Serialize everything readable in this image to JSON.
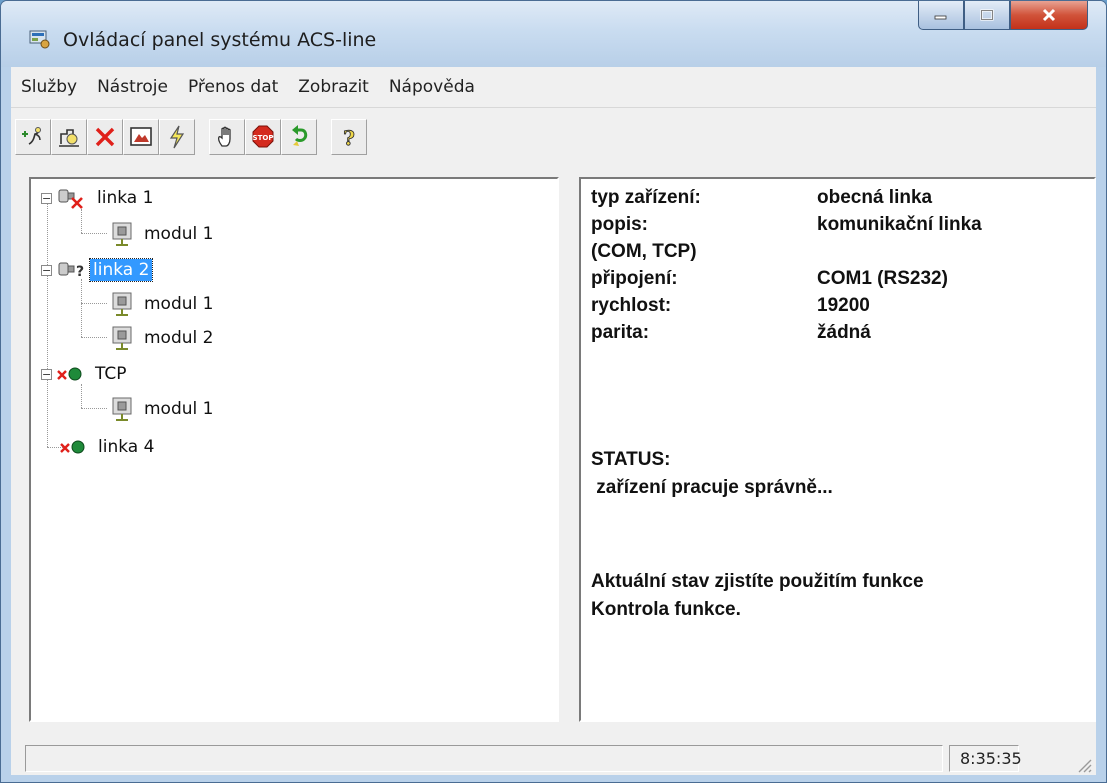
{
  "window": {
    "title": "Ovládací panel systému ACS-line"
  },
  "menu": [
    "Služby",
    "Nástroje",
    "Přenos dat",
    "Zobrazit",
    "Nápověda"
  ],
  "toolbar": {
    "buttons": [
      {
        "icon": "add-device-icon"
      },
      {
        "icon": "device-properties-icon"
      },
      {
        "icon": "delete-icon"
      },
      {
        "icon": "picture-icon"
      },
      {
        "icon": "lightning-icon"
      },
      {
        "icon": "hand-icon"
      },
      {
        "icon": "stop-icon"
      },
      {
        "icon": "undo-arrow-icon"
      },
      {
        "icon": "help-icon"
      }
    ]
  },
  "tree": {
    "nodes": [
      {
        "label": "linka 1",
        "level": 0,
        "expander": "−",
        "icon": "line-error-icon"
      },
      {
        "label": "modul 1",
        "level": 1,
        "icon": "module-icon"
      },
      {
        "label": "linka 2",
        "level": 0,
        "expander": "−",
        "icon": "line-unknown-icon",
        "selected": true
      },
      {
        "label": "modul 1",
        "level": 1,
        "icon": "module-icon"
      },
      {
        "label": "modul 2",
        "level": 1,
        "icon": "module-icon"
      },
      {
        "label": "TCP",
        "level": 0,
        "expander": "−",
        "icon": "tcp-error-icon"
      },
      {
        "label": "modul 1",
        "level": 1,
        "icon": "module-icon"
      },
      {
        "label": "linka 4",
        "level": 0,
        "icon": "tcp-error-icon"
      }
    ]
  },
  "info": {
    "typ_label": "typ zařízení:",
    "typ_value": "obecná linka",
    "popis_label": "popis:",
    "popis_value": "komunikační linka",
    "popis_cont": "(COM, TCP)",
    "pripojeni_label": "připojení:",
    "pripojeni_value": "COM1 (RS232)",
    "rychlost_label": "rychlost:",
    "rychlost_value": "19200",
    "parita_label": "parita:",
    "parita_value": "žádná",
    "status_label": "STATUS:",
    "status_value": " zařízení pracuje správně...",
    "hint_line1": "Aktuální stav zjistíte použitím funkce",
    "hint_line2": "Kontrola funkce."
  },
  "statusbar": {
    "time": "8:35:35"
  },
  "colors": {
    "selection": "#3399ff",
    "close_button": "#c3311a"
  }
}
